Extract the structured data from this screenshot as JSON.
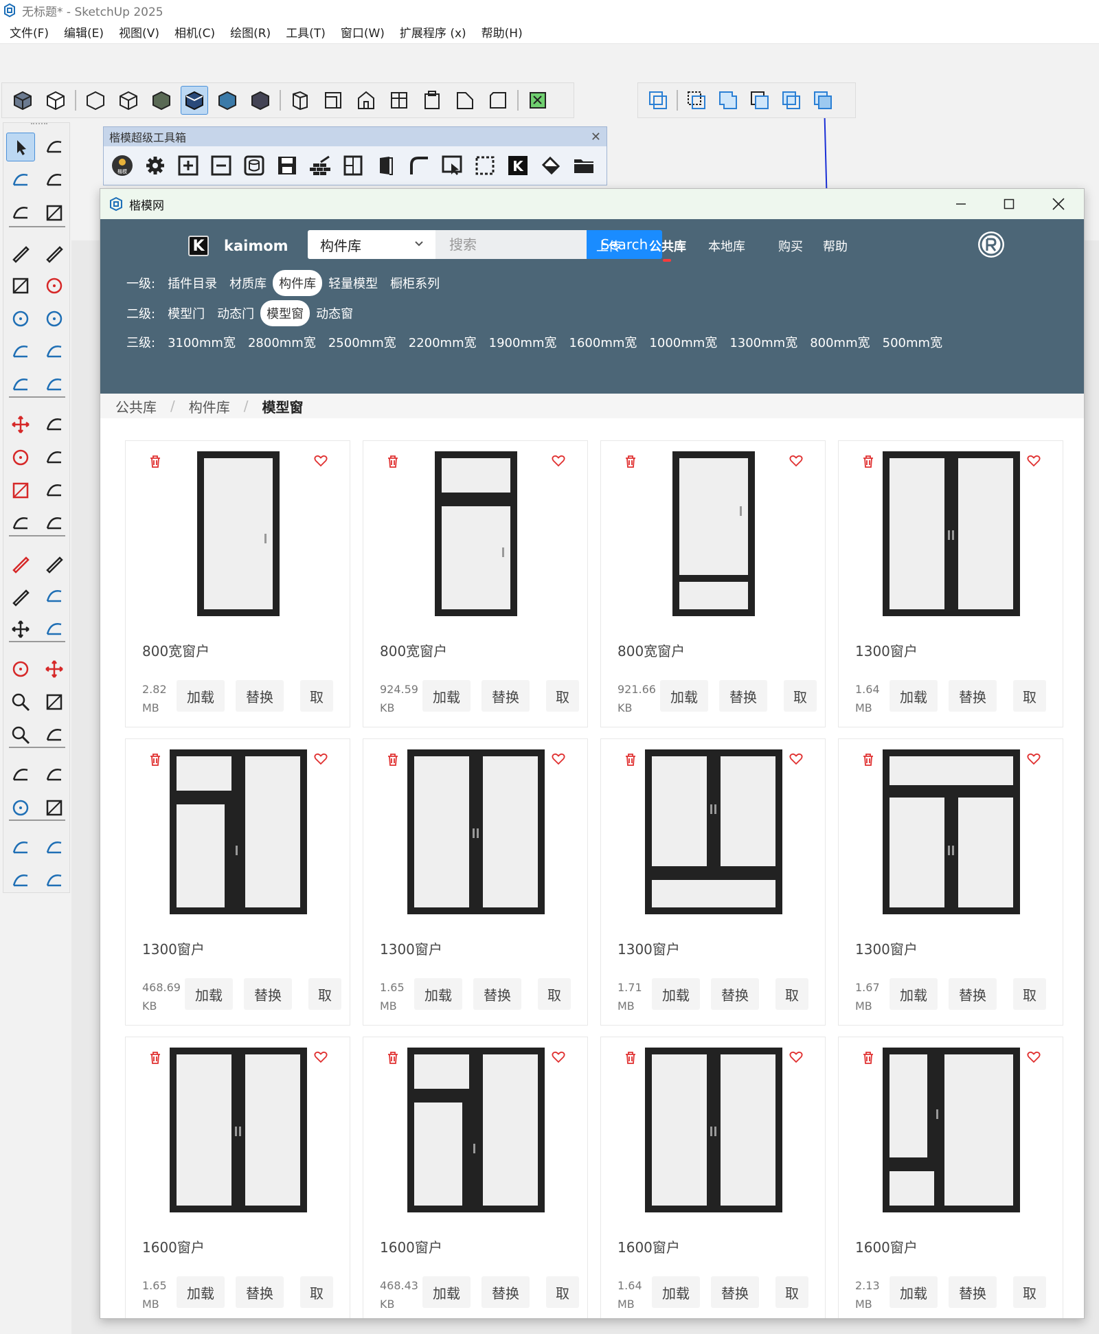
{
  "app": {
    "title": "无标题* - SketchUp 2025"
  },
  "menu": [
    "文件(F)",
    "编辑(E)",
    "视图(V)",
    "相机(C)",
    "绘图(R)",
    "工具(T)",
    "窗口(W)",
    "扩展程序 (x)",
    "帮助(H)"
  ],
  "toolbox": {
    "title": "楷模超级工具箱",
    "logo_text": "楷模"
  },
  "kaimo": {
    "window_title": "楷模网",
    "brand": "kaimom",
    "brand_letter": "K",
    "category": "构件库",
    "search_placeholder": "搜索",
    "search_button": "Search",
    "nav": [
      "上传",
      "公共库",
      "本地库",
      "购买",
      "帮助"
    ],
    "nav_active": "公共库",
    "level1": {
      "label": "一级:",
      "items": [
        "插件目录",
        "材质库",
        "构件库",
        "轻量模型",
        "橱柜系列"
      ],
      "selected": "构件库"
    },
    "level2": {
      "label": "二级:",
      "items": [
        "模型门",
        "动态门",
        "模型窗",
        "动态窗"
      ],
      "selected": "模型窗"
    },
    "level3": {
      "label": "三级:",
      "items": [
        "3100mm宽",
        "2800mm宽",
        "2500mm宽",
        "2200mm宽",
        "1900mm宽",
        "1600mm宽",
        "1000mm宽",
        "1300mm宽",
        "800mm宽",
        "500mm宽"
      ]
    },
    "breadcrumb": [
      "公共库",
      "构件库",
      "模型窗"
    ],
    "actions": {
      "load": "加载",
      "replace": "替换",
      "take": "取"
    },
    "items": [
      {
        "name": "800宽窗户",
        "size": "2.82",
        "unit": "MB",
        "style": "single"
      },
      {
        "name": "800宽窗户",
        "size": "924.59",
        "unit": "KB",
        "style": "single-top"
      },
      {
        "name": "800宽窗户",
        "size": "921.66",
        "unit": "KB",
        "style": "single-bottom"
      },
      {
        "name": "1300窗户",
        "size": "1.64",
        "unit": "MB",
        "style": "double"
      },
      {
        "name": "1300窗户",
        "size": "468.69",
        "unit": "KB",
        "style": "left-split"
      },
      {
        "name": "1300窗户",
        "size": "1.65",
        "unit": "MB",
        "style": "double"
      },
      {
        "name": "1300窗户",
        "size": "1.71",
        "unit": "MB",
        "style": "double-bottom"
      },
      {
        "name": "1300窗户",
        "size": "1.67",
        "unit": "MB",
        "style": "double-top"
      },
      {
        "name": "1600窗户",
        "size": "1.65",
        "unit": "MB",
        "style": "double"
      },
      {
        "name": "1600窗户",
        "size": "468.43",
        "unit": "KB",
        "style": "left-split"
      },
      {
        "name": "1600窗户",
        "size": "1.64",
        "unit": "MB",
        "style": "double"
      },
      {
        "name": "1600窗户",
        "size": "2.13",
        "unit": "MB",
        "style": "left-split-b"
      }
    ]
  },
  "colors": {
    "nav_bg": "#4c6677",
    "accent": "#1a8cff",
    "frame": "#222222",
    "glass": "#efefef",
    "icon_red": "#e03030"
  }
}
